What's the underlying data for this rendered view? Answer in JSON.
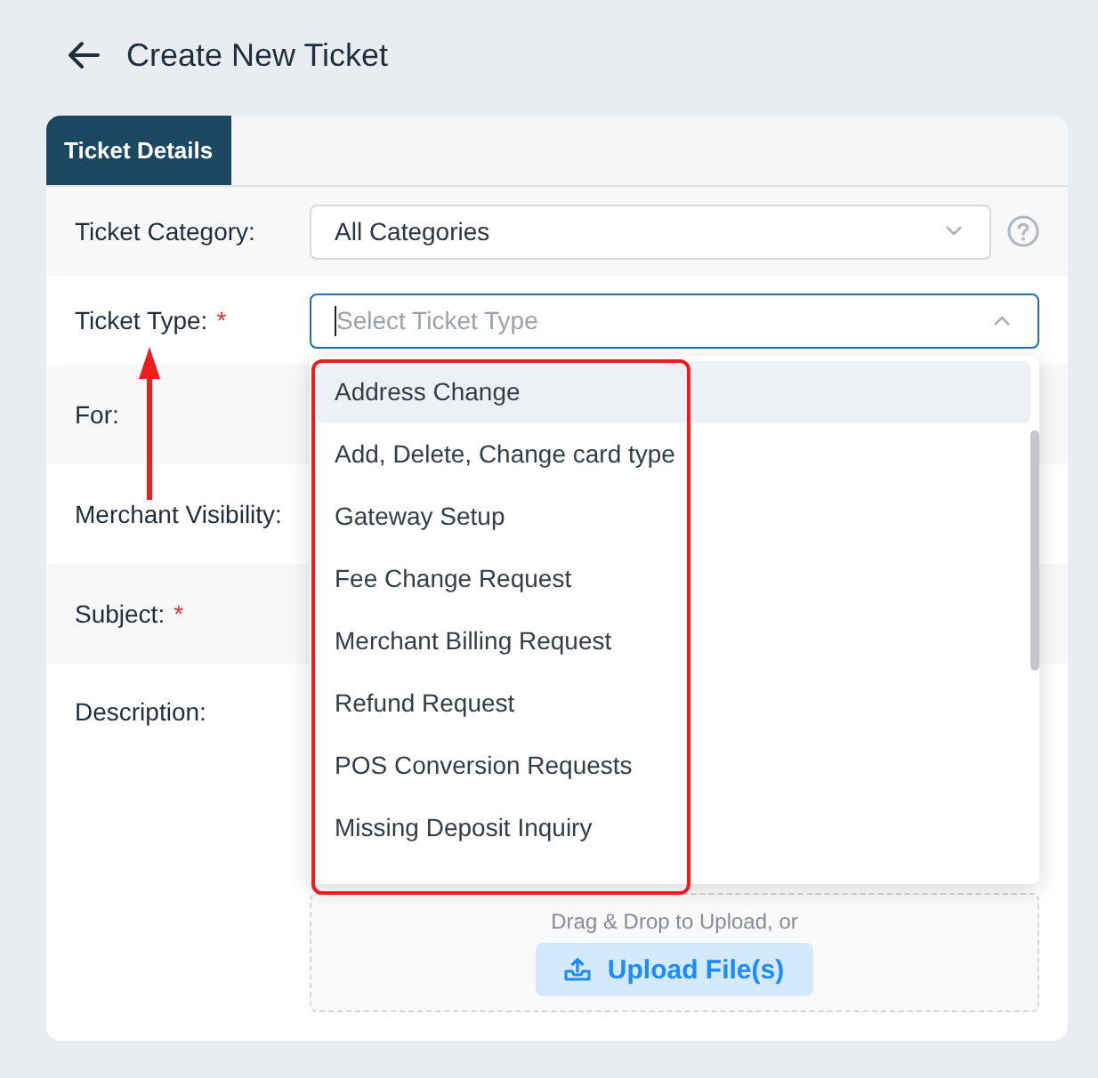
{
  "header": {
    "title": "Create New Ticket"
  },
  "tabs": [
    {
      "label": "Ticket Details",
      "selected": true
    }
  ],
  "form": {
    "rows": [
      {
        "kind": "select",
        "label": "Ticket Category:",
        "value": "All Categories",
        "expanded": false,
        "help": true
      },
      {
        "kind": "select",
        "label": "Ticket Type:",
        "required_mark": "*",
        "placeholder": "Select Ticket Type",
        "expanded": true,
        "options": [
          {
            "label": "Address Change",
            "highlighted": true
          },
          {
            "label": "Add, Delete, Change card type",
            "highlighted": false
          },
          {
            "label": "Gateway Setup",
            "highlighted": false
          },
          {
            "label": "Fee Change Request",
            "highlighted": false
          },
          {
            "label": "Merchant Billing Request",
            "highlighted": false
          },
          {
            "label": "Refund Request",
            "highlighted": false
          },
          {
            "label": "POS Conversion Requests",
            "highlighted": false
          },
          {
            "label": "Missing Deposit Inquiry",
            "highlighted": false
          }
        ]
      },
      {
        "kind": "plain",
        "label": "For:"
      },
      {
        "kind": "plain",
        "label": "Merchant Visibility:"
      },
      {
        "kind": "plain",
        "label": "Subject:",
        "required_mark": "*"
      },
      {
        "kind": "upload",
        "label": "Description:",
        "drop_text": "Drag & Drop to Upload, or",
        "button": "Upload File(s)"
      }
    ]
  }
}
